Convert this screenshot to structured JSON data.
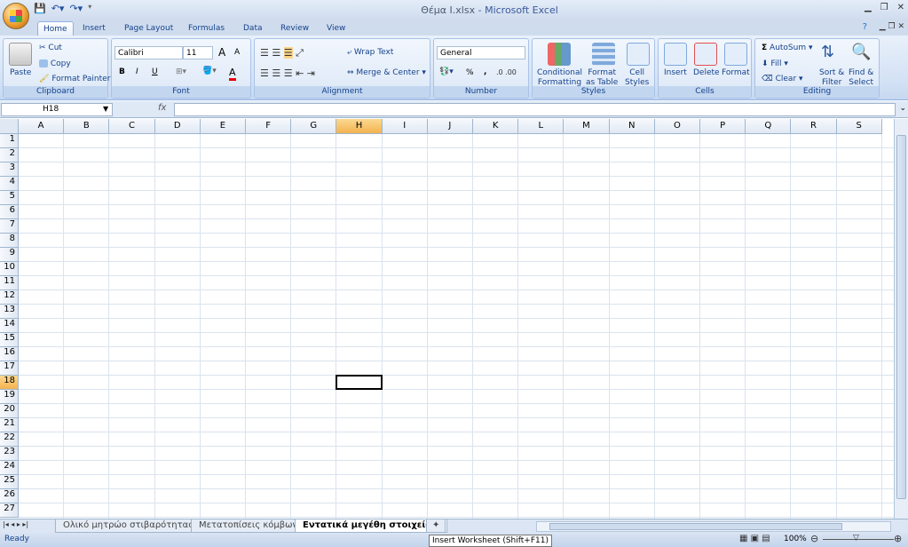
{
  "title": {
    "file": "Θέμα Ι.xlsx",
    "app": "Microsoft Excel",
    "separator": " - "
  },
  "qat": [
    "save-icon",
    "undo-icon",
    "redo-icon"
  ],
  "tabs": [
    "Home",
    "Insert",
    "Page Layout",
    "Formulas",
    "Data",
    "Review",
    "View"
  ],
  "ribbon": {
    "clipboard": {
      "label": "Clipboard",
      "paste": "Paste",
      "cut": "Cut",
      "copy": "Copy",
      "format_painter": "Format Painter"
    },
    "font": {
      "label": "Font",
      "family": "Calibri",
      "size": "11",
      "bold": "B",
      "italic": "I",
      "underline": "U",
      "font_color": "A",
      "grow": "A",
      "shrink": "A"
    },
    "alignment": {
      "label": "Alignment",
      "wrap": "Wrap Text",
      "merge": "Merge & Center"
    },
    "number": {
      "label": "Number",
      "format": "General",
      "percent": "%",
      "comma": ","
    },
    "styles": {
      "label": "Styles",
      "conditional": [
        "Conditional",
        "Formatting"
      ],
      "table": [
        "Format",
        "as Table"
      ],
      "cell": [
        "Cell",
        "Styles"
      ]
    },
    "cells": {
      "label": "Cells",
      "insert": "Insert",
      "delete": "Delete",
      "format": "Format"
    },
    "editing": {
      "label": "Editing",
      "autosum": "AutoSum",
      "fill": "Fill",
      "clear": "Clear",
      "sort": [
        "Sort &",
        "Filter"
      ],
      "find": [
        "Find &",
        "Select"
      ]
    }
  },
  "formula_bar": {
    "name_box": "H18",
    "fx": "fx",
    "value": ""
  },
  "grid": {
    "columns": [
      "A",
      "B",
      "C",
      "D",
      "E",
      "F",
      "G",
      "H",
      "I",
      "J",
      "K",
      "L",
      "M",
      "N",
      "O",
      "P",
      "Q",
      "R",
      "S"
    ],
    "rows": [
      "1",
      "2",
      "3",
      "4",
      "5",
      "6",
      "7",
      "8",
      "9",
      "10",
      "11",
      "12",
      "13",
      "14",
      "15",
      "16",
      "17",
      "18",
      "19",
      "20",
      "21",
      "22",
      "23",
      "24",
      "25",
      "26",
      "27"
    ],
    "selected_column": "H",
    "selected_row": "18"
  },
  "sheets": [
    "Ολικό μητρώο στιβαρότητας",
    "Μετατοπίσεις κόμβων",
    "Εντατικά μεγέθη στοιχείων"
  ],
  "active_sheet": 2,
  "status": {
    "ready": "Ready",
    "zoom": "100%",
    "tooltip": "Insert Worksheet (Shift+F11)"
  }
}
